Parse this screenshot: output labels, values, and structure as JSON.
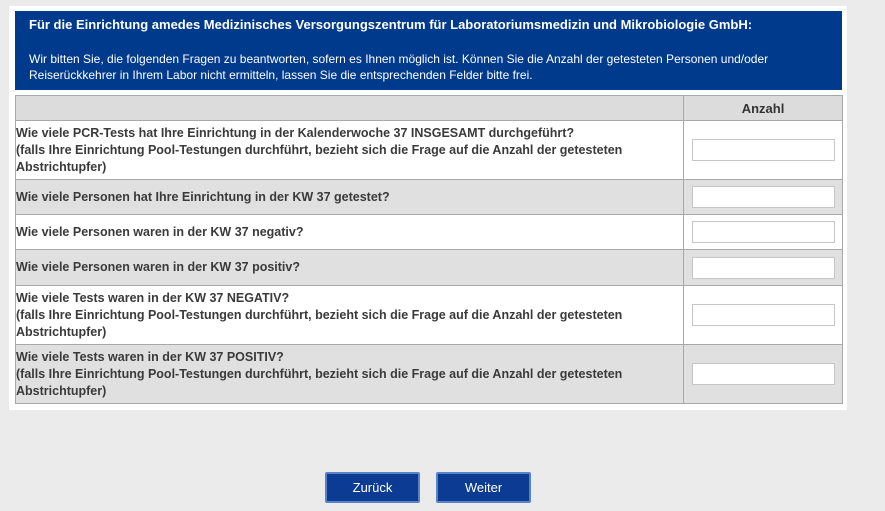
{
  "header": {
    "title": "Für die Einrichtung amedes Medizinisches Versorgungszentrum für Laboratoriumsmedizin und Mikrobiologie GmbH:",
    "intro": "Wir bitten Sie, die folgenden Fragen zu beantworten, sofern es Ihnen möglich ist. Können Sie die Anzahl der getesteten Personen und/oder Reiserückkehrer in Ihrem Labor nicht ermitteln, lassen Sie die entsprechenden Felder bitte frei."
  },
  "table": {
    "col_header": "Anzahl",
    "rows": [
      {
        "q1": "Wie viele PCR-Tests hat Ihre Einrichtung in der Kalenderwoche 37 INSGESAMT durchgeführt?",
        "q2": "(falls Ihre Einrichtung Pool-Testungen durchführt, bezieht sich die Frage auf die Anzahl der getesteten Abstrichtupfer)",
        "value": ""
      },
      {
        "q1": "Wie viele Personen hat Ihre Einrichtung in der KW 37 getestet?",
        "q2": "",
        "value": ""
      },
      {
        "q1": "Wie viele Personen waren in der KW 37 negativ?",
        "q2": "",
        "value": ""
      },
      {
        "q1": "Wie viele Personen waren in der KW 37 positiv?",
        "q2": "",
        "value": ""
      },
      {
        "q1": "Wie viele Tests waren in der KW 37 NEGATIV?",
        "q2": "(falls Ihre Einrichtung Pool-Testungen durchführt, bezieht sich die Frage auf die Anzahl der getesteten Abstrichtupfer)",
        "value": ""
      },
      {
        "q1": "Wie viele Tests waren in der KW 37 POSITIV?",
        "q2": "(falls Ihre Einrichtung Pool-Testungen durchführt, bezieht sich die Frage auf die Anzahl der getesteten Abstrichtupfer)",
        "value": ""
      }
    ]
  },
  "nav": {
    "back_label": "Zurück",
    "next_label": "Weiter"
  }
}
